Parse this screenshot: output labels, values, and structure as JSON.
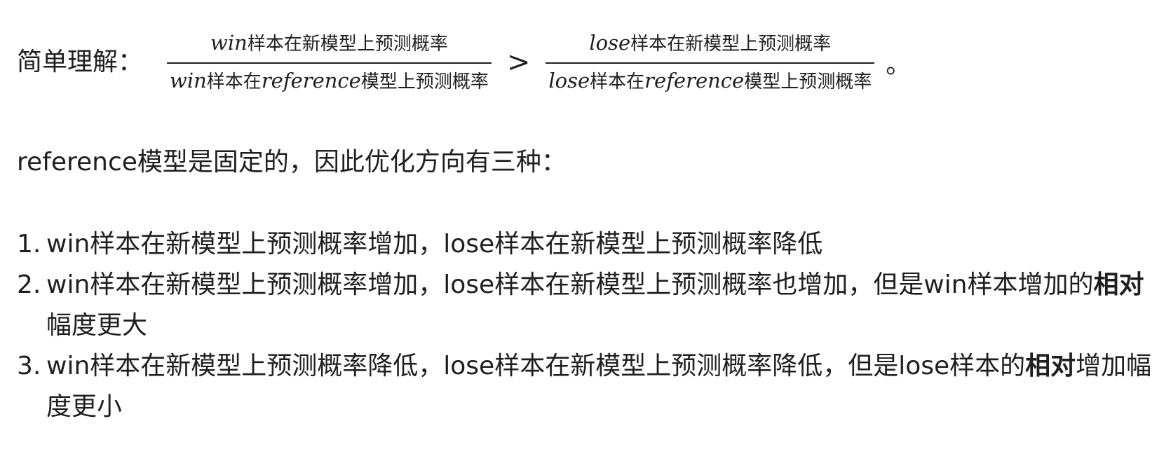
{
  "formula": {
    "label": "简单理解：",
    "left_fraction": {
      "numerator_var": "win",
      "numerator_text": "样本在新模型上预测概率",
      "denominator_var": "win",
      "denominator_mid": "样本在",
      "denominator_ref": "reference",
      "denominator_text": "模型上预测概率"
    },
    "operator": ">",
    "right_fraction": {
      "numerator_var": "lose",
      "numerator_text": "样本在新模型上预测概率",
      "denominator_var": "lose",
      "denominator_mid": "样本在",
      "denominator_ref": "reference",
      "denominator_text": "模型上预测概率"
    },
    "end_mark": "。"
  },
  "intro": "reference模型是固定的，因此优化方向有三种：",
  "list": [
    {
      "number": "1.",
      "text_before": "win样本在新模型上预测概率增加，lose样本在新模型上预测概率降低",
      "bold": "",
      "text_after": ""
    },
    {
      "number": "2.",
      "text_before": "win样本在新模型上预测概率增加，lose样本在新模型上预测概率也增加，但是win样本增加的",
      "bold": "相对",
      "text_after": "幅度更大"
    },
    {
      "number": "3.",
      "text_before": "win样本在新模型上预测概率降低，lose样本在新模型上预测概率降低，但是lose样本的",
      "bold": "相对",
      "text_after": "增加幅度更小"
    }
  ]
}
